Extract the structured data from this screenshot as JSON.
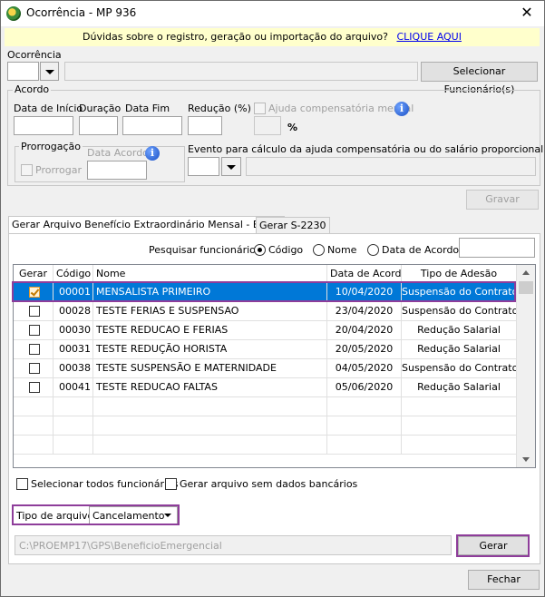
{
  "window": {
    "title": "Ocorrência - MP 936"
  },
  "info_bar": {
    "text": "Dúvidas sobre o registro, geração ou importação do arquivo?",
    "link": "CLIQUE AQUI"
  },
  "ocorrencia": {
    "label": "Ocorrência",
    "select_button": "Selecionar Funcionário(s)"
  },
  "acordo": {
    "title": "Acordo",
    "data_inicio": "Data de Início",
    "duracao": "Duração",
    "data_fim": "Data Fim",
    "reducao": "Redução (%)",
    "percent_sign": "%",
    "ajuda_label": "Ajuda compensatória mensal",
    "prorrogacao": {
      "title": "Prorrogação",
      "prorrogar": "Prorrogar",
      "data_acordo": "Data Acordo"
    },
    "evento_label": "Evento para cálculo da ajuda compensatória ou do salário proporcional"
  },
  "gravar_button": "Gravar",
  "tabs": [
    {
      "label": "Gerar Arquivo Benefício Extraordinário Mensal - B.E.M",
      "active": true
    },
    {
      "label": "Gerar S-2230",
      "active": false
    }
  ],
  "search": {
    "label": "Pesquisar funcionário",
    "options": [
      "Código",
      "Nome",
      "Data de Acordo"
    ],
    "selected": "Código"
  },
  "grid": {
    "headers": [
      "Gerar",
      "Código",
      "Nome",
      "Data de Acordo",
      "Tipo de Adesão"
    ],
    "rows": [
      {
        "checked": true,
        "codigo": "00001",
        "nome": "MENSALISTA PRIMEIRO",
        "data": "10/04/2020",
        "tipo": "Suspensão do Contrato"
      },
      {
        "checked": false,
        "codigo": "00028",
        "nome": "TESTE FERIAS E SUSPENSAO",
        "data": "23/04/2020",
        "tipo": "Suspensão do Contrato"
      },
      {
        "checked": false,
        "codigo": "00030",
        "nome": "TESTE REDUCAO E FERIAS",
        "data": "20/04/2020",
        "tipo": "Redução Salarial"
      },
      {
        "checked": false,
        "codigo": "00031",
        "nome": "TESTE REDUÇÃO HORISTA",
        "data": "20/05/2020",
        "tipo": "Redução Salarial"
      },
      {
        "checked": false,
        "codigo": "00038",
        "nome": "TESTE SUSPENSÃO E MATERNIDADE",
        "data": "04/05/2020",
        "tipo": "Suspensão do Contrato"
      },
      {
        "checked": false,
        "codigo": "00041",
        "nome": "TESTE REDUCAO FALTAS",
        "data": "05/06/2020",
        "tipo": "Redução Salarial"
      }
    ]
  },
  "options": {
    "select_all": "Selecionar todos funcionários",
    "sem_dados_bancarios": "Gerar arquivo sem dados bancários"
  },
  "tipo_arquivo": {
    "label": "Tipo de arquivo",
    "value": "Cancelamento"
  },
  "path": {
    "value": "C:\\PROEMP17\\GPS\\BeneficioEmergencial"
  },
  "gerar_button": "Gerar",
  "fechar_button": "Fechar",
  "colors": {
    "selection": "#0078d7",
    "highlight": "#8e3d9a",
    "info_bar": "#ffffcc",
    "link": "#0000ee"
  }
}
